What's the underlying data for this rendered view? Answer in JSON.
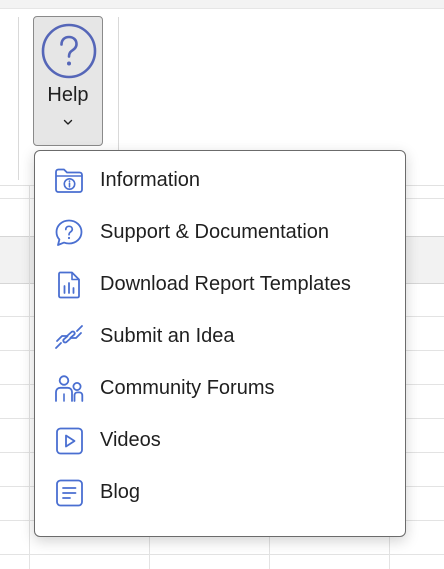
{
  "ribbon": {
    "help_button": {
      "label": "Help",
      "icon": "question-circle-icon",
      "dropdown_icon": "chevron-down-icon"
    }
  },
  "help_menu": {
    "items": [
      {
        "label": "Information",
        "icon": "folder-info-icon"
      },
      {
        "label": "Support & Documentation",
        "icon": "chat-question-icon"
      },
      {
        "label": "Download Report Templates",
        "icon": "report-chart-icon"
      },
      {
        "label": "Submit an Idea",
        "icon": "handshake-idea-icon"
      },
      {
        "label": "Community Forums",
        "icon": "people-icon"
      },
      {
        "label": "Videos",
        "icon": "video-play-icon"
      },
      {
        "label": "Blog",
        "icon": "document-lines-icon"
      }
    ]
  },
  "colors": {
    "icon_blue": "#4a6fd1",
    "help_icon_purple": "#5566b8",
    "text": "#1f1f1f"
  }
}
